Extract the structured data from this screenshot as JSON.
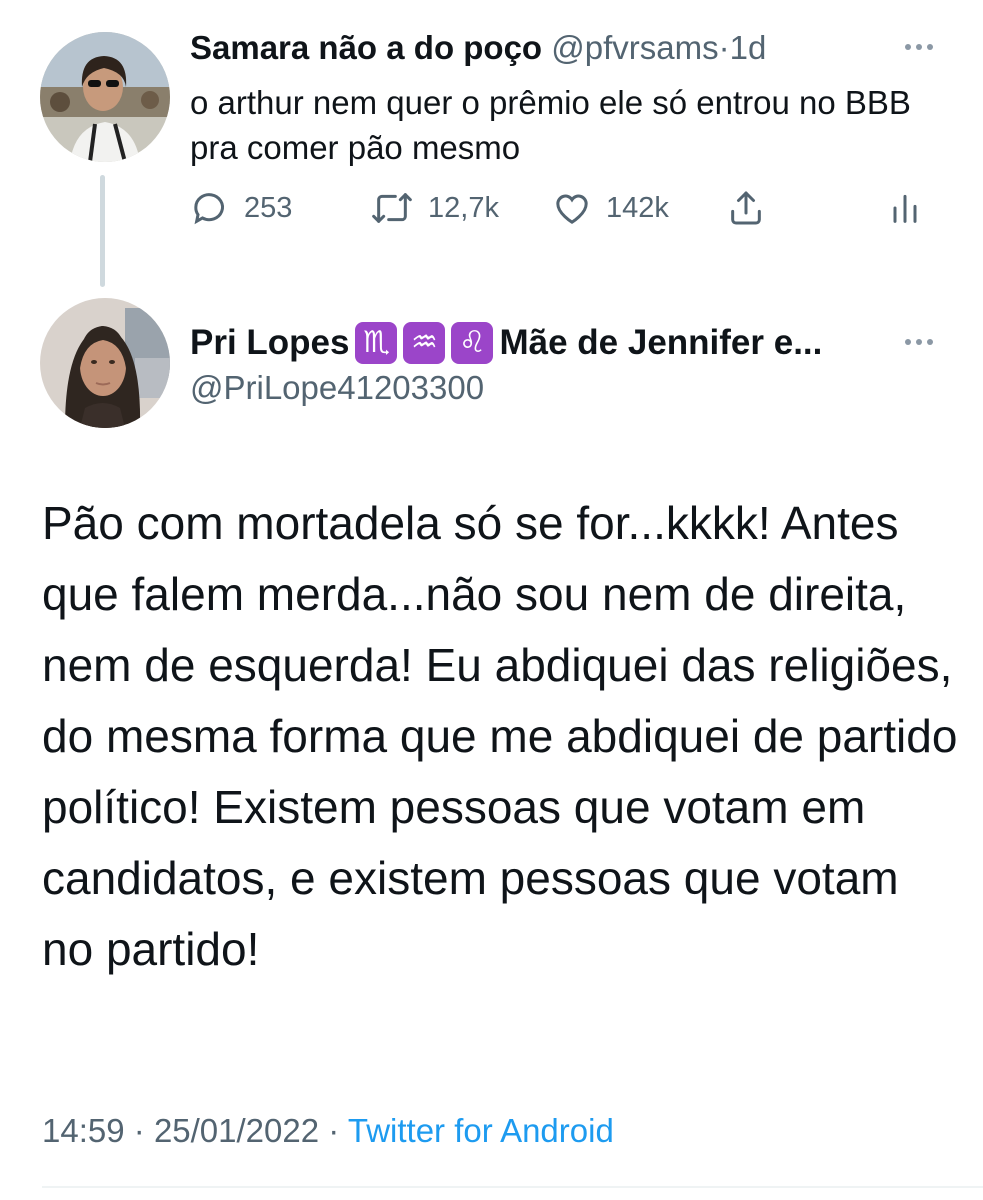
{
  "tweet_quoted": {
    "display_name": "Samara não a do poço",
    "handle": "@pfvrsams",
    "separator": "·",
    "time": "1d",
    "text": "o arthur nem quer o prêmio ele só entrou no BBB pra comer pão mesmo",
    "replies": "253",
    "retweets": "12,7k",
    "likes": "142k"
  },
  "tweet_main": {
    "display_name_prefix": "Pri Lopes",
    "zodiac_emojis": [
      "♏",
      "♒",
      "♌"
    ],
    "display_name_suffix": "Mãe de Jennifer e...",
    "handle": "@PriLope41203300",
    "text": "Pão com mortadela só se for...kkkk! Antes que falem merda...não sou nem de direita, nem de esquerda! Eu abdiquei das religiões, do mesma forma que me abdiquei de partido político! Existem pessoas que votam em candidatos, e existem pessoas que votam no partido!",
    "time": "14:59",
    "date": "25/01/2022",
    "separator": "·",
    "source": "Twitter for Android"
  },
  "colors": {
    "text_primary": "#0f1419",
    "text_secondary": "#536471",
    "link": "#1d9bf0",
    "thread_line": "#cfd9de",
    "zodiac_bg": "#9b45c9"
  },
  "icons": [
    "reply-icon",
    "retweet-icon",
    "like-icon",
    "share-icon",
    "analytics-icon",
    "more-icon"
  ]
}
